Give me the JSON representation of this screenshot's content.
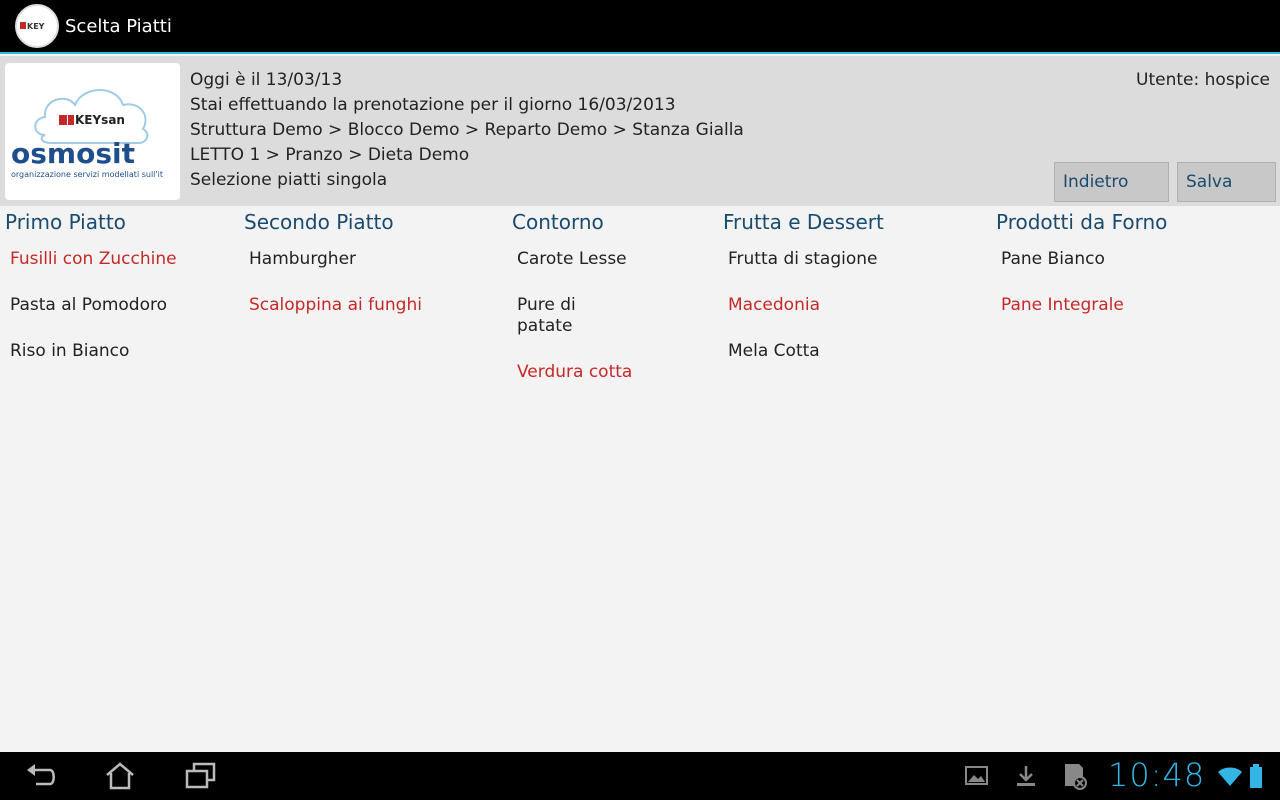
{
  "app": {
    "title": "Scelta Piatti"
  },
  "header": {
    "lines": [
      "Oggi è il 13/03/13",
      "Stai effettuando la prenotazione per il giorno 16/03/2013",
      "Struttura Demo > Blocco Demo > Reparto Demo > Stanza Gialla",
      "LETTO 1 > Pranzo > Dieta Demo",
      "Selezione piatti singola"
    ],
    "user": "Utente: hospice",
    "back_label": "Indietro",
    "save_label": "Salva",
    "logo": {
      "keysan": "KEYsan",
      "osmosit": "osmosit",
      "tagline": "organizzazione servizi modellati sull'it"
    }
  },
  "columns": [
    {
      "title": "Primo Piatto",
      "items": [
        {
          "label": "Fusilli con Zucchine",
          "selected": true
        },
        {
          "label": "Pasta al Pomodoro",
          "selected": false
        },
        {
          "label": "Riso in Bianco",
          "selected": false
        }
      ]
    },
    {
      "title": "Secondo Piatto",
      "items": [
        {
          "label": "Hamburgher",
          "selected": false
        },
        {
          "label": "Scaloppina ai funghi",
          "selected": true
        }
      ]
    },
    {
      "title": "Contorno",
      "items": [
        {
          "label": "Carote Lesse",
          "selected": false
        },
        {
          "label": "Pure di patate",
          "selected": false
        },
        {
          "label": "Verdura cotta",
          "selected": true
        }
      ]
    },
    {
      "title": "Frutta e Dessert",
      "items": [
        {
          "label": "Frutta di stagione",
          "selected": false
        },
        {
          "label": "Macedonia",
          "selected": true
        },
        {
          "label": "Mela Cotta",
          "selected": false
        }
      ]
    },
    {
      "title": "Prodotti da Forno",
      "items": [
        {
          "label": "Pane Bianco",
          "selected": false
        },
        {
          "label": "Pane Integrale",
          "selected": true
        }
      ]
    }
  ],
  "statusbar": {
    "time": "10:48"
  },
  "colors": {
    "accent": "#33b5e5",
    "selected": "#c62828",
    "header_text": "#1a4a6e"
  }
}
